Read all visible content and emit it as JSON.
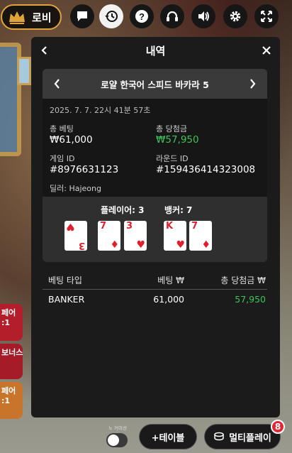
{
  "top_bar": {
    "lobby_label": "로비",
    "icons": [
      "chat-icon",
      "history-icon",
      "help-icon",
      "headset-icon",
      "volume-icon",
      "gear-icon",
      "fullscreen-icon"
    ],
    "accent_color": "#e0a53a"
  },
  "side_buttons": [
    {
      "line1": "페어",
      "line2": ":1"
    },
    {
      "line1": "보너스",
      "line2": ""
    },
    {
      "line1": "페어",
      "line2": ":1"
    }
  ],
  "modal": {
    "title": "내역",
    "game": {
      "name": "로얄 한국어 스피드 바카라 5",
      "datetime": "2025. 7. 7. 22시 41분 57초",
      "total_bet_label": "총 베팅",
      "total_bet_value": "₩61,000",
      "total_win_label": "총 당첨금",
      "total_win_value": "₩57,950",
      "game_id_label": "게임 ID",
      "game_id_value": "#8976631123",
      "round_id_label": "라운드 ID",
      "round_id_value": "#159436414323008",
      "dealer": "딜러: Hajeong"
    },
    "hands": {
      "player_label": "플레이어: 3",
      "banker_label": "뱅커: 7",
      "player_cards": [
        {
          "rank": "3",
          "suit": "♥",
          "rotated": true
        },
        {
          "rank": "7",
          "suit": "♦",
          "rotated": false
        },
        {
          "rank": "3",
          "suit": "♥",
          "rotated": false
        }
      ],
      "banker_cards": [
        {
          "rank": "K",
          "suit": "♥",
          "rotated": false
        },
        {
          "rank": "7",
          "suit": "♦",
          "rotated": false
        }
      ],
      "card_color": "#e01e2e"
    },
    "table": {
      "headers": [
        "베팅 타입",
        "베팅 ₩",
        "총 당첨금 ₩"
      ],
      "rows": [
        {
          "type": "BANKER",
          "bet": "61,000",
          "win": "57,950"
        }
      ],
      "win_color": "#3ec55a"
    }
  },
  "bottom_bar": {
    "toggle_label": "노 커미션",
    "add_table_label": "+테이블",
    "multiplay_label": "멀티플레이",
    "badge_count": "8"
  }
}
